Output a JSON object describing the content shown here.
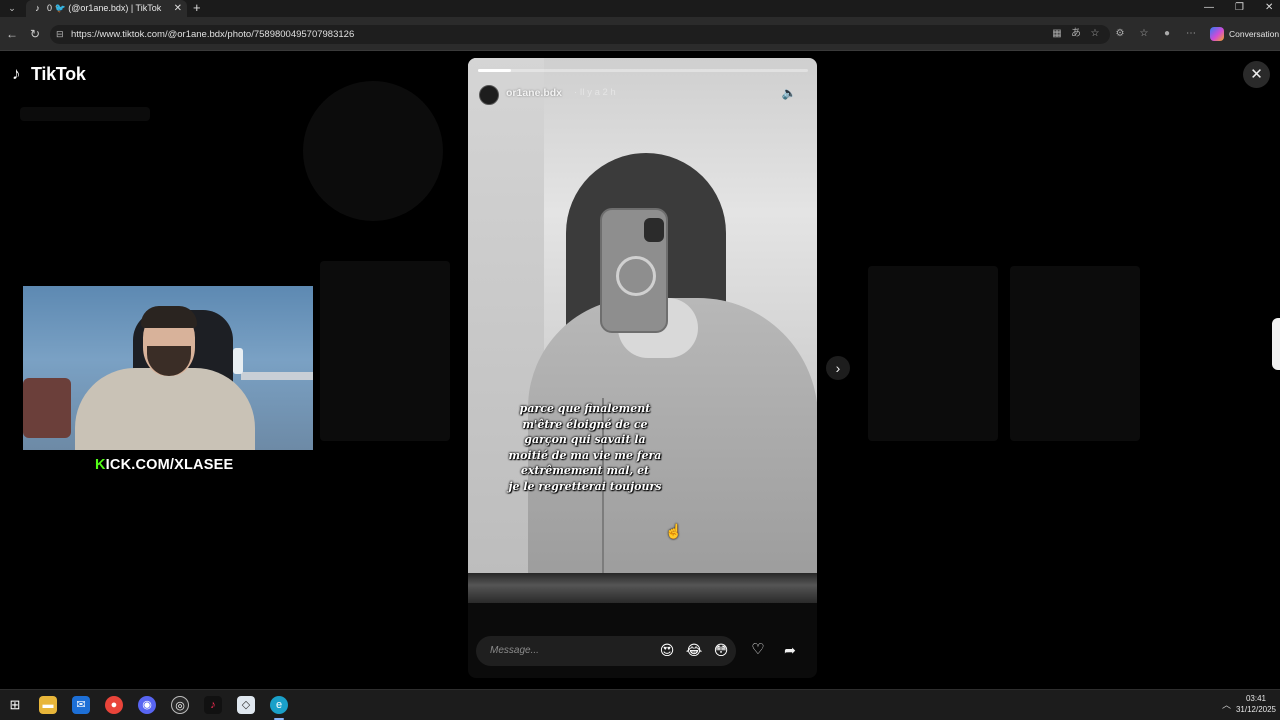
{
  "browser": {
    "tab_title": "0 🐦 (@or1ane.bdx) | TikTok",
    "url": "https://www.tiktok.com/@or1ane.bdx/photo/7589800495707983126",
    "copilot_label": "Conversation"
  },
  "page": {
    "logo_text": "TikTok",
    "close_icon": "close-icon",
    "next_icon": "chevron-right-icon"
  },
  "webcam": {
    "caption": "ICK.COM/XLASEE",
    "caption_accent": "K",
    "accent_color": "#53fc18"
  },
  "story": {
    "username": "or1ane.bdx",
    "time_ago": "· Il y a 2 h",
    "progress": 0.1,
    "caption_lines": [
      "parce que finalement",
      "m'être éloigné de ce",
      "garçon qui savait la",
      "moitié de ma vie me fera",
      "extrêmement mal, et",
      "je le regretterai toujours"
    ],
    "message_placeholder": "Message...",
    "emojis": [
      "😍",
      "😂",
      "😳"
    ]
  },
  "taskbar": {
    "time": "03:41",
    "date": "31/12/2025",
    "apps": [
      "windows-start",
      "file-explorer",
      "outlook",
      "chrome",
      "discord",
      "obs",
      "tiktok",
      "app",
      "edge"
    ]
  }
}
